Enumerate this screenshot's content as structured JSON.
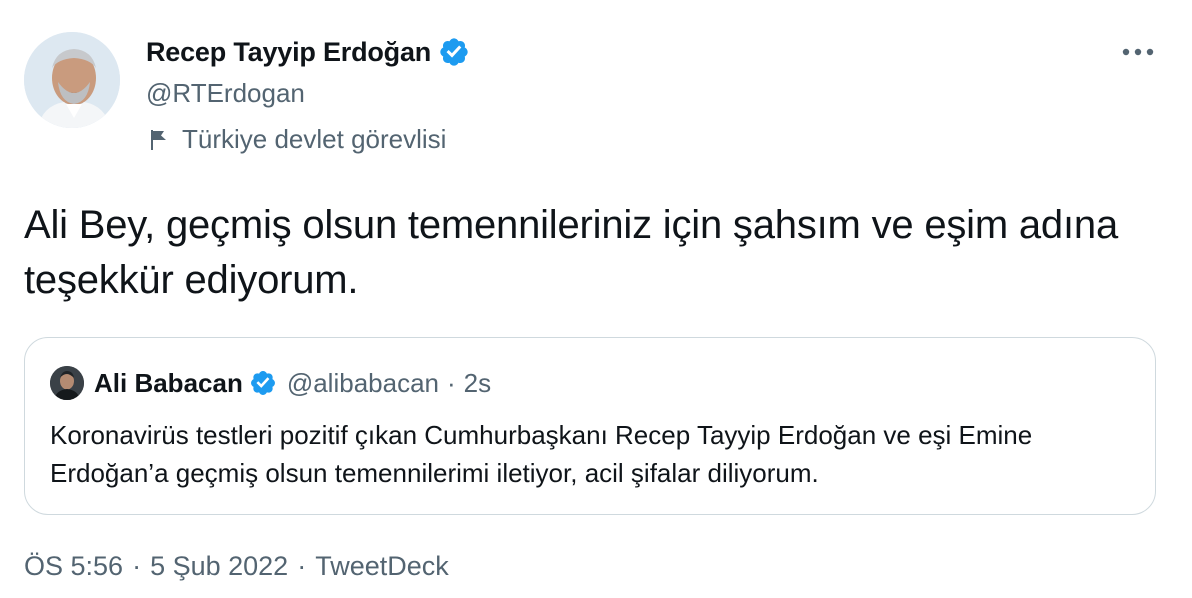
{
  "author": {
    "display_name": "Recep Tayyip Erdoğan",
    "handle": "@RTErdogan",
    "label": "Türkiye devlet görevlisi",
    "avatar_icon": "profile-photo",
    "verified_icon": "verified-badge-icon"
  },
  "tweet": {
    "text": "Ali Bey, geçmiş olsun temennileriniz için şahsım ve eşim adına teşekkür ediyorum."
  },
  "quoted": {
    "display_name": "Ali Babacan",
    "handle": "@alibabacan",
    "separator": "·",
    "time": "2s",
    "text": "Koronavirüs testleri pozitif çıkan Cumhurbaşkanı Recep Tayyip Erdoğan ve eşi Emine Erdoğan’a geçmiş olsun temennilerimi iletiyor, acil şifalar diliyorum."
  },
  "meta": {
    "time": "ÖS 5:56",
    "sep1": "·",
    "date": "5 Şub 2022",
    "sep2": "·",
    "source": "TweetDeck"
  },
  "colors": {
    "verified": "#1d9bf0",
    "secondary_text": "#536471",
    "border": "#cfd9de",
    "primary_text": "#0f1419"
  }
}
